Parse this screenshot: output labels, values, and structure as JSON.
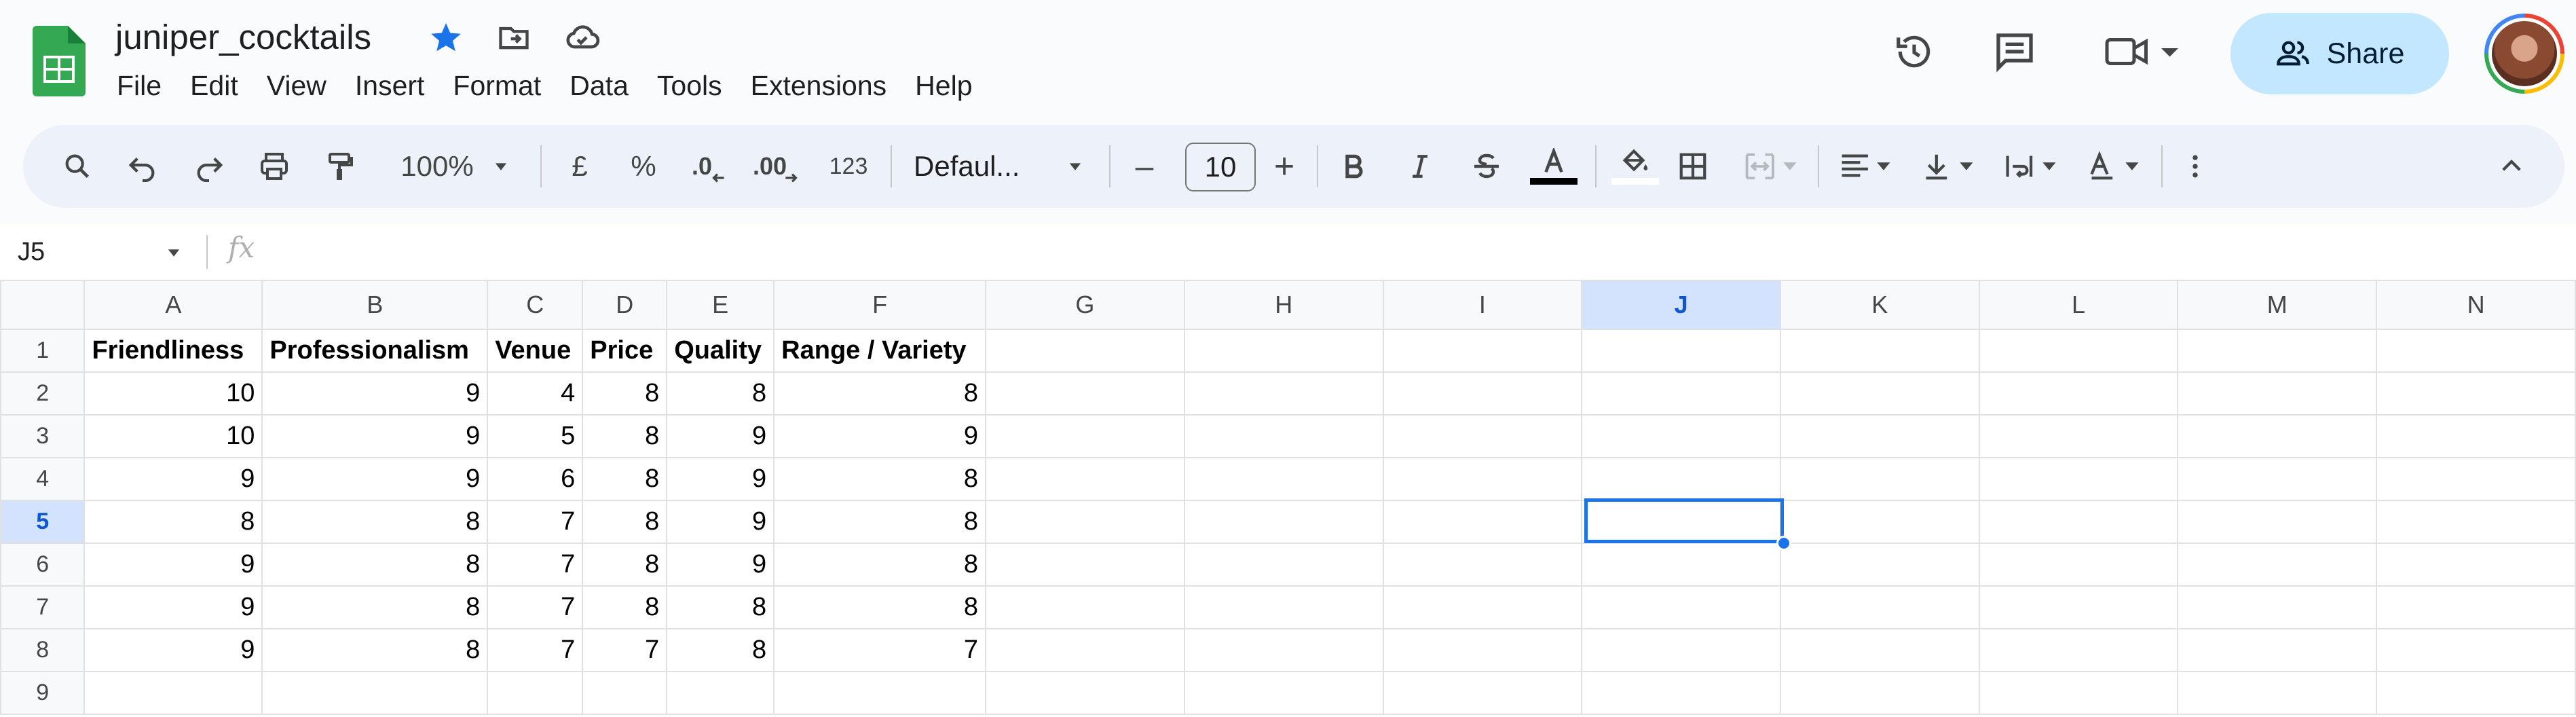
{
  "app": {
    "doc_title": "juniper_cocktails",
    "icons": [
      "sheets-logo-icon",
      "star-icon",
      "move-to-folder-icon",
      "cloud-status-icon"
    ]
  },
  "menu": [
    "File",
    "Edit",
    "View",
    "Insert",
    "Format",
    "Data",
    "Tools",
    "Extensions",
    "Help"
  ],
  "header_actions": {
    "share_label": "Share",
    "icons": [
      "version-history-icon",
      "comments-icon",
      "meet-icon",
      "avatar"
    ]
  },
  "toolbar": {
    "zoom": "100%",
    "currency": "£",
    "percent": "%",
    "decrease_decimals": ".0",
    "increase_decimals": ".00",
    "format_more": "123",
    "font_family": "Defaul...",
    "font_size": "10",
    "minus": "–",
    "plus": "+"
  },
  "formula_bar": {
    "name_box": "J5",
    "fx_label": "fx",
    "value": ""
  },
  "grid": {
    "columns": [
      "A",
      "B",
      "C",
      "D",
      "E",
      "F",
      "G",
      "H",
      "I",
      "J",
      "K",
      "L",
      "M",
      "N"
    ],
    "selected_column": "J",
    "selected_row": "5",
    "rows": [
      "1",
      "2",
      "3",
      "4",
      "5",
      "6",
      "7",
      "8",
      "9"
    ],
    "header_row": [
      "Friendliness",
      "Professionalism",
      "Venue",
      "Price",
      "Quality",
      "Range / Variety"
    ],
    "data_rows": [
      [
        "10",
        "9",
        "4",
        "8",
        "8",
        "8"
      ],
      [
        "10",
        "9",
        "5",
        "8",
        "9",
        "9"
      ],
      [
        "9",
        "9",
        "6",
        "8",
        "9",
        "8"
      ],
      [
        "8",
        "8",
        "7",
        "8",
        "9",
        "8"
      ],
      [
        "9",
        "8",
        "7",
        "8",
        "9",
        "8"
      ],
      [
        "9",
        "8",
        "7",
        "8",
        "8",
        "8"
      ],
      [
        "9",
        "8",
        "7",
        "7",
        "8",
        "7"
      ]
    ]
  },
  "colors": {
    "accent": "#1a73e8",
    "share_bg": "#c2e7ff",
    "selected_header_bg": "#d3e3fd",
    "logo_green": "#34a853"
  }
}
